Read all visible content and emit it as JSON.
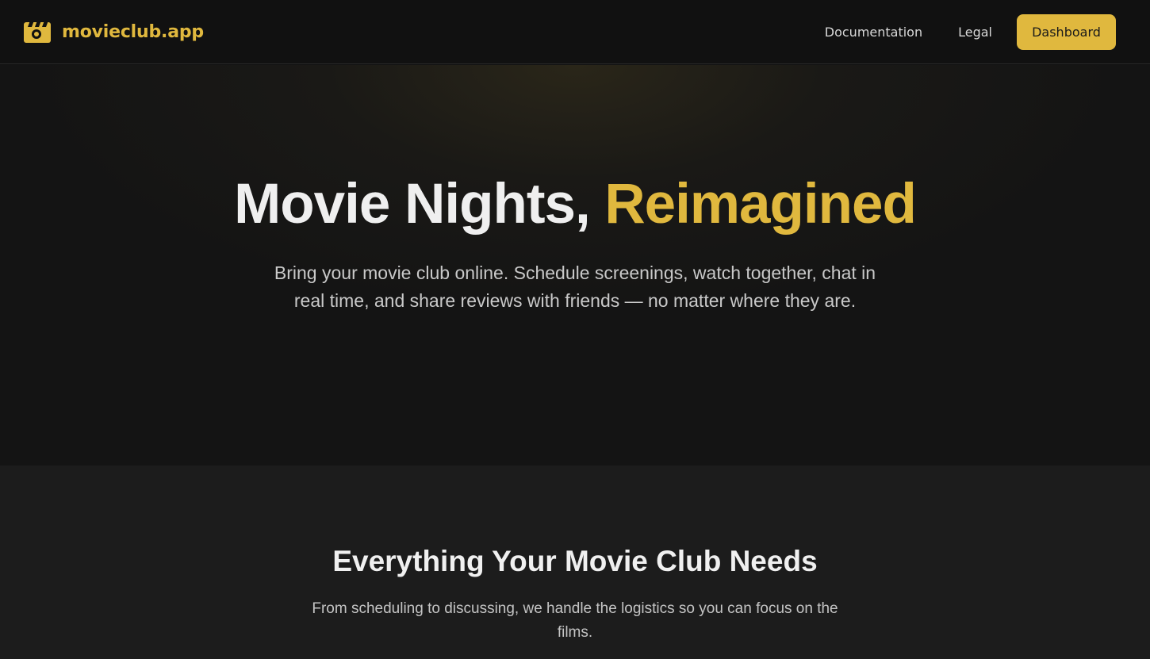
{
  "brand": {
    "name": "movieclub.app",
    "icon": "film-camera-icon",
    "color": "#e0b83e"
  },
  "nav": {
    "links": [
      {
        "label": "Documentation"
      },
      {
        "label": "Legal"
      }
    ],
    "dashboard_label": "Dashboard"
  },
  "hero": {
    "title_main": "Movie Nights, ",
    "title_accent": "Reimagined",
    "subtitle_line1": "Bring your movie club online. Schedule screenings, watch together, chat in",
    "subtitle_line2": "real time, and share reviews with friends — no matter where they are."
  },
  "features": {
    "title": "Everything Your Movie Club Needs",
    "subtitle_line1": "From scheduling to discussing, we handle the logistics so you can focus on the",
    "subtitle_line2": "films."
  },
  "colors": {
    "accent": "#e0b83e",
    "background": "#111111",
    "section": "#1c1c1c"
  }
}
